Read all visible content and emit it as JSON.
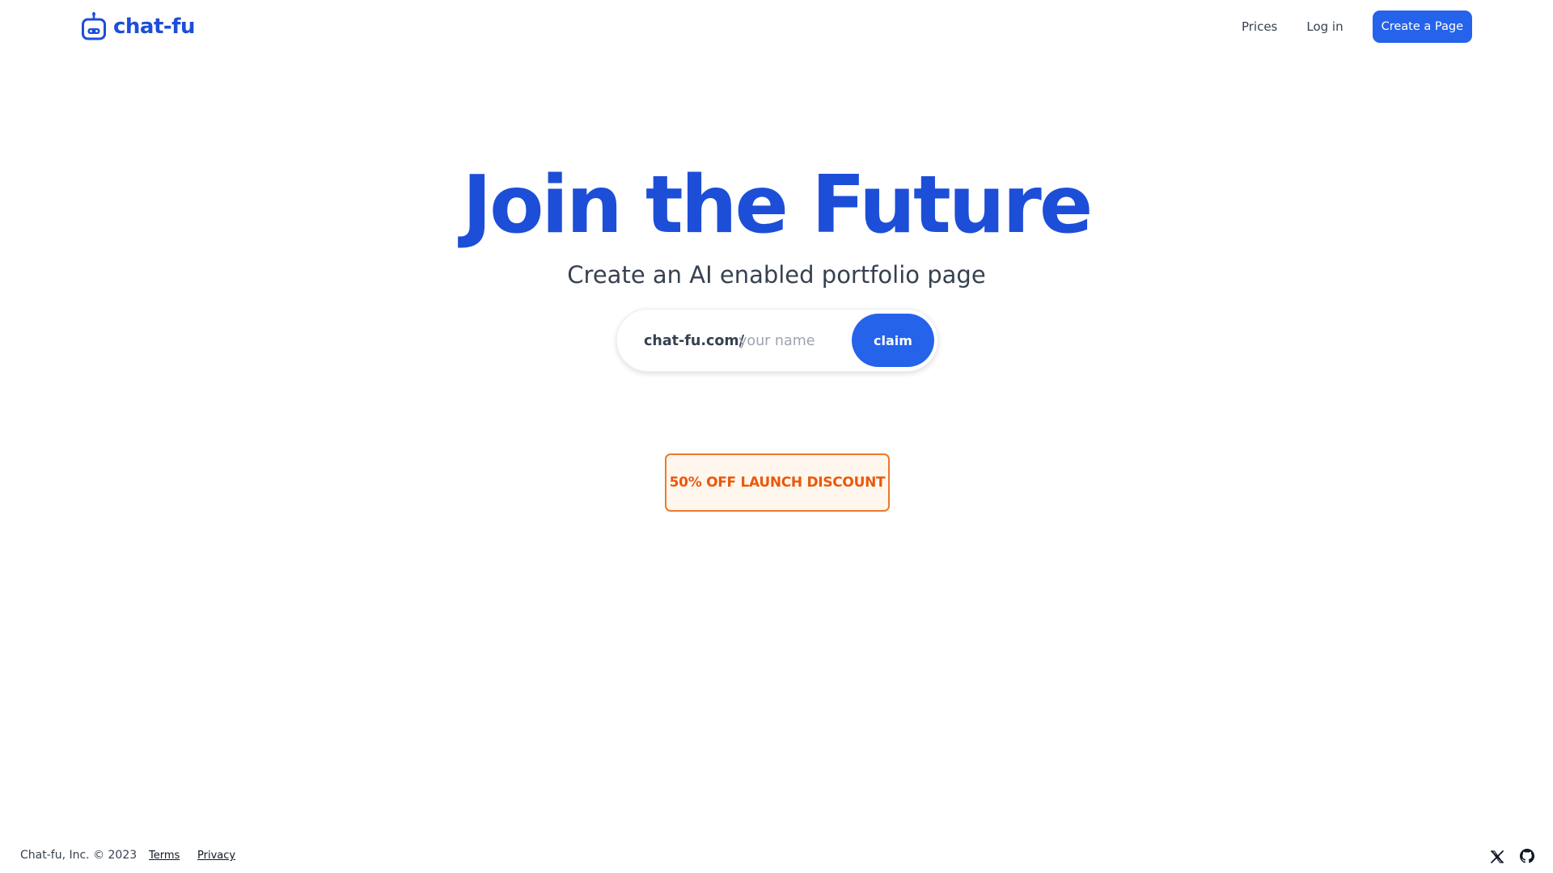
{
  "header": {
    "brand": {
      "name": "chat-fu",
      "icon": "robot-icon"
    },
    "nav": {
      "prices": "Prices",
      "login": "Log in",
      "cta": "Create a Page"
    }
  },
  "hero": {
    "title": "Join the Future",
    "subtitle": "Create an AI enabled portfolio page",
    "claim": {
      "prefix": "chat-fu.com/",
      "value": "",
      "placeholder": "your name",
      "button": "claim"
    },
    "promo": "50% OFF LAUNCH DISCOUNT"
  },
  "footer": {
    "copyright": "Chat-fu, Inc. © 2023",
    "terms": "Terms",
    "privacy": "Privacy",
    "social": [
      "x-icon",
      "github-icon"
    ]
  },
  "colors": {
    "brand_blue": "#1d4ed8",
    "button_blue": "#2563eb",
    "promo_orange": "#ea580c",
    "promo_bg": "#fff7ed"
  }
}
